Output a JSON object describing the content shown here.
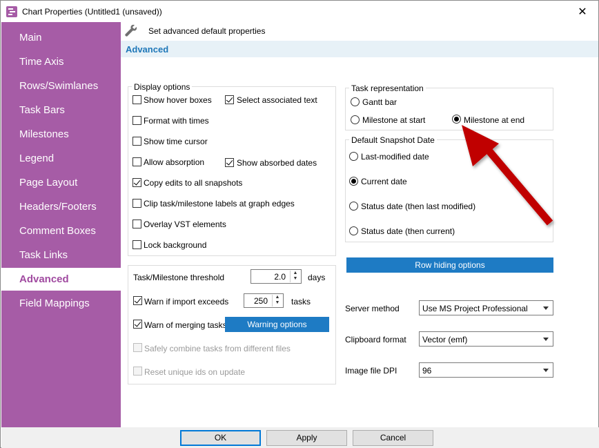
{
  "window": {
    "title": "Chart Properties (Untitled1 (unsaved))",
    "close_glyph": "✕"
  },
  "sidebar": {
    "items": [
      {
        "label": "Main"
      },
      {
        "label": "Time Axis"
      },
      {
        "label": "Rows/Swimlanes"
      },
      {
        "label": "Task Bars"
      },
      {
        "label": "Milestones"
      },
      {
        "label": "Legend"
      },
      {
        "label": "Page Layout"
      },
      {
        "label": "Headers/Footers"
      },
      {
        "label": "Comment Boxes"
      },
      {
        "label": "Task Links"
      },
      {
        "label": "Advanced"
      },
      {
        "label": "Field Mappings"
      }
    ],
    "active_index": 10,
    "color": "#a65ca6"
  },
  "header": {
    "text": "Set advanced default properties",
    "icon": "wrench-icon"
  },
  "section": {
    "title": "Advanced",
    "color": "#1e77b8"
  },
  "display_options": {
    "title": "Display options",
    "show_hover_boxes": {
      "label": "Show hover boxes",
      "checked": false
    },
    "select_associated_text": {
      "label": "Select associated text",
      "checked": true
    },
    "format_with_times": {
      "label": "Format with times",
      "checked": false
    },
    "show_time_cursor": {
      "label": "Show time cursor",
      "checked": false
    },
    "allow_absorption": {
      "label": "Allow absorption",
      "checked": false
    },
    "show_absorbed_dates": {
      "label": "Show absorbed dates",
      "checked": true
    },
    "copy_edits": {
      "label": "Copy edits to all snapshots",
      "checked": true
    },
    "clip_labels": {
      "label": "Clip task/milestone labels at graph edges",
      "checked": false
    },
    "overlay_vst": {
      "label": "Overlay VST elements",
      "checked": false
    },
    "lock_background": {
      "label": "Lock background",
      "checked": false
    }
  },
  "import_options": {
    "threshold_label": "Task/Milestone threshold",
    "threshold_value": "2.0",
    "threshold_unit": "days",
    "warn_import": {
      "label": "Warn if import exceeds",
      "checked": true
    },
    "warn_import_value": "250",
    "warn_import_unit": "tasks",
    "warn_merging": {
      "label": "Warn of merging tasks",
      "checked": true
    },
    "warning_options_button": "Warning options",
    "safely_combine": {
      "label": "Safely combine tasks from different files",
      "checked": false
    },
    "reset_ids": {
      "label": "Reset unique ids on update",
      "checked": false
    }
  },
  "task_representation": {
    "title": "Task representation",
    "options": [
      {
        "label": "Gantt bar",
        "selected": false
      },
      {
        "label": "Milestone at start",
        "selected": false
      },
      {
        "label": "Milestone at end",
        "selected": true
      }
    ]
  },
  "snapshot_date": {
    "title": "Default Snapshot Date",
    "options": [
      {
        "label": "Last-modified date",
        "selected": false
      },
      {
        "label": "Current date",
        "selected": true
      },
      {
        "label": "Status date (then last modified)",
        "selected": false
      },
      {
        "label": "Status date (then current)",
        "selected": false
      }
    ]
  },
  "row_hiding_button": "Row hiding options",
  "settings": {
    "server_method": {
      "label": "Server method",
      "value": "Use MS Project Professional"
    },
    "clipboard_format": {
      "label": "Clipboard format",
      "value": "Vector (emf)"
    },
    "image_dpi": {
      "label": "Image file DPI",
      "value": "96"
    }
  },
  "footer": {
    "ok": "OK",
    "apply": "Apply",
    "cancel": "Cancel"
  },
  "colors": {
    "accent_blue": "#1e7bc4",
    "annotation_arrow": "#c00000"
  }
}
